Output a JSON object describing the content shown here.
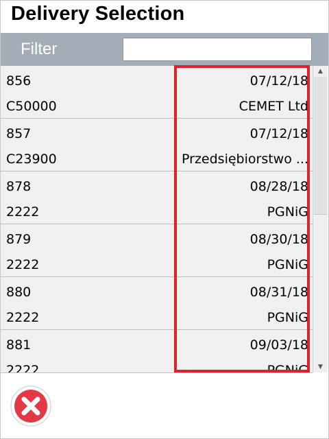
{
  "header": {
    "title": "Delivery Selection"
  },
  "filter": {
    "label": "Filter",
    "value": ""
  },
  "deliveries": [
    {
      "id": "856",
      "code": "C50000",
      "date": "07/12/18",
      "name": "CEMET Ltd"
    },
    {
      "id": "857",
      "code": "C23900",
      "date": "07/12/18",
      "name": "Przedsiębiorstwo ..."
    },
    {
      "id": "878",
      "code": "2222",
      "date": "08/28/18",
      "name": "PGNiG"
    },
    {
      "id": "879",
      "code": "2222",
      "date": "08/30/18",
      "name": "PGNiG"
    },
    {
      "id": "880",
      "code": "2222",
      "date": "08/31/18",
      "name": "PGNiG"
    },
    {
      "id": "881",
      "code": "2222",
      "date": "09/03/18",
      "name": "PGNiG"
    }
  ],
  "icons": {
    "cancel": "close-circle-icon",
    "scroll_up": "chevron-up-icon",
    "scroll_down": "chevron-down-icon"
  },
  "colors": {
    "filter_bar": "#a2adb7",
    "highlight": "#e0202c",
    "cancel": "#e23a44",
    "list_bg": "#f0f0f0"
  }
}
